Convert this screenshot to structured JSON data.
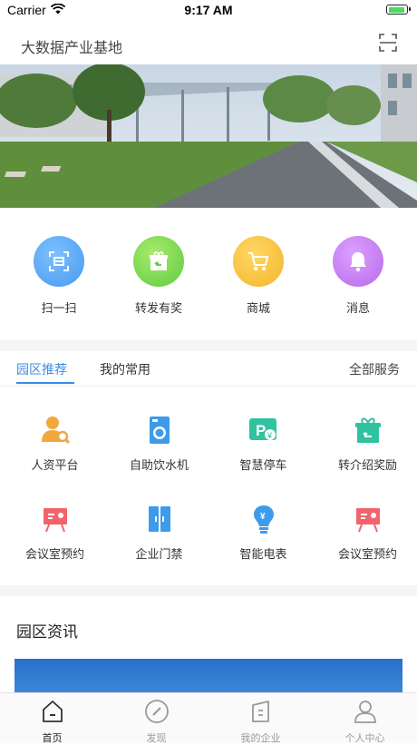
{
  "status_bar": {
    "carrier": "Carrier",
    "time": "9:17 AM"
  },
  "header": {
    "title": "大数据产业基地",
    "scan_icon": "scan-frame-icon"
  },
  "quick_actions": [
    {
      "label": "扫一扫",
      "icon": "scan-icon",
      "color": "#5aaaf7"
    },
    {
      "label": "转发有奖",
      "icon": "gift-share-icon",
      "color": "#7fd65c"
    },
    {
      "label": "商城",
      "icon": "cart-icon",
      "color": "#f7c23d"
    },
    {
      "label": "消息",
      "icon": "bell-icon",
      "color": "#c67af0"
    }
  ],
  "services": {
    "tabs": [
      {
        "label": "园区推荐",
        "active": true
      },
      {
        "label": "我的常用",
        "active": false
      }
    ],
    "all_label": "全部服务",
    "accent": "#3c8ce7",
    "items": [
      {
        "label": "人资平台",
        "icon": "person-search-icon"
      },
      {
        "label": "自助饮水机",
        "icon": "water-dispenser-icon"
      },
      {
        "label": "智慧停车",
        "icon": "parking-icon"
      },
      {
        "label": "转介绍奖励",
        "icon": "gift-icon"
      },
      {
        "label": "会议室预约",
        "icon": "meeting-board-icon"
      },
      {
        "label": "企业门禁",
        "icon": "door-access-icon"
      },
      {
        "label": "智能电表",
        "icon": "smart-meter-icon"
      },
      {
        "label": "会议室预约",
        "icon": "meeting-board-icon"
      }
    ]
  },
  "news": {
    "heading": "园区资讯"
  },
  "tabbar": [
    {
      "label": "首页",
      "icon": "home-icon",
      "active": true
    },
    {
      "label": "发现",
      "icon": "compass-icon",
      "active": false
    },
    {
      "label": "我的企业",
      "icon": "building-icon",
      "active": false
    },
    {
      "label": "个人中心",
      "icon": "profile-icon",
      "active": false
    }
  ]
}
